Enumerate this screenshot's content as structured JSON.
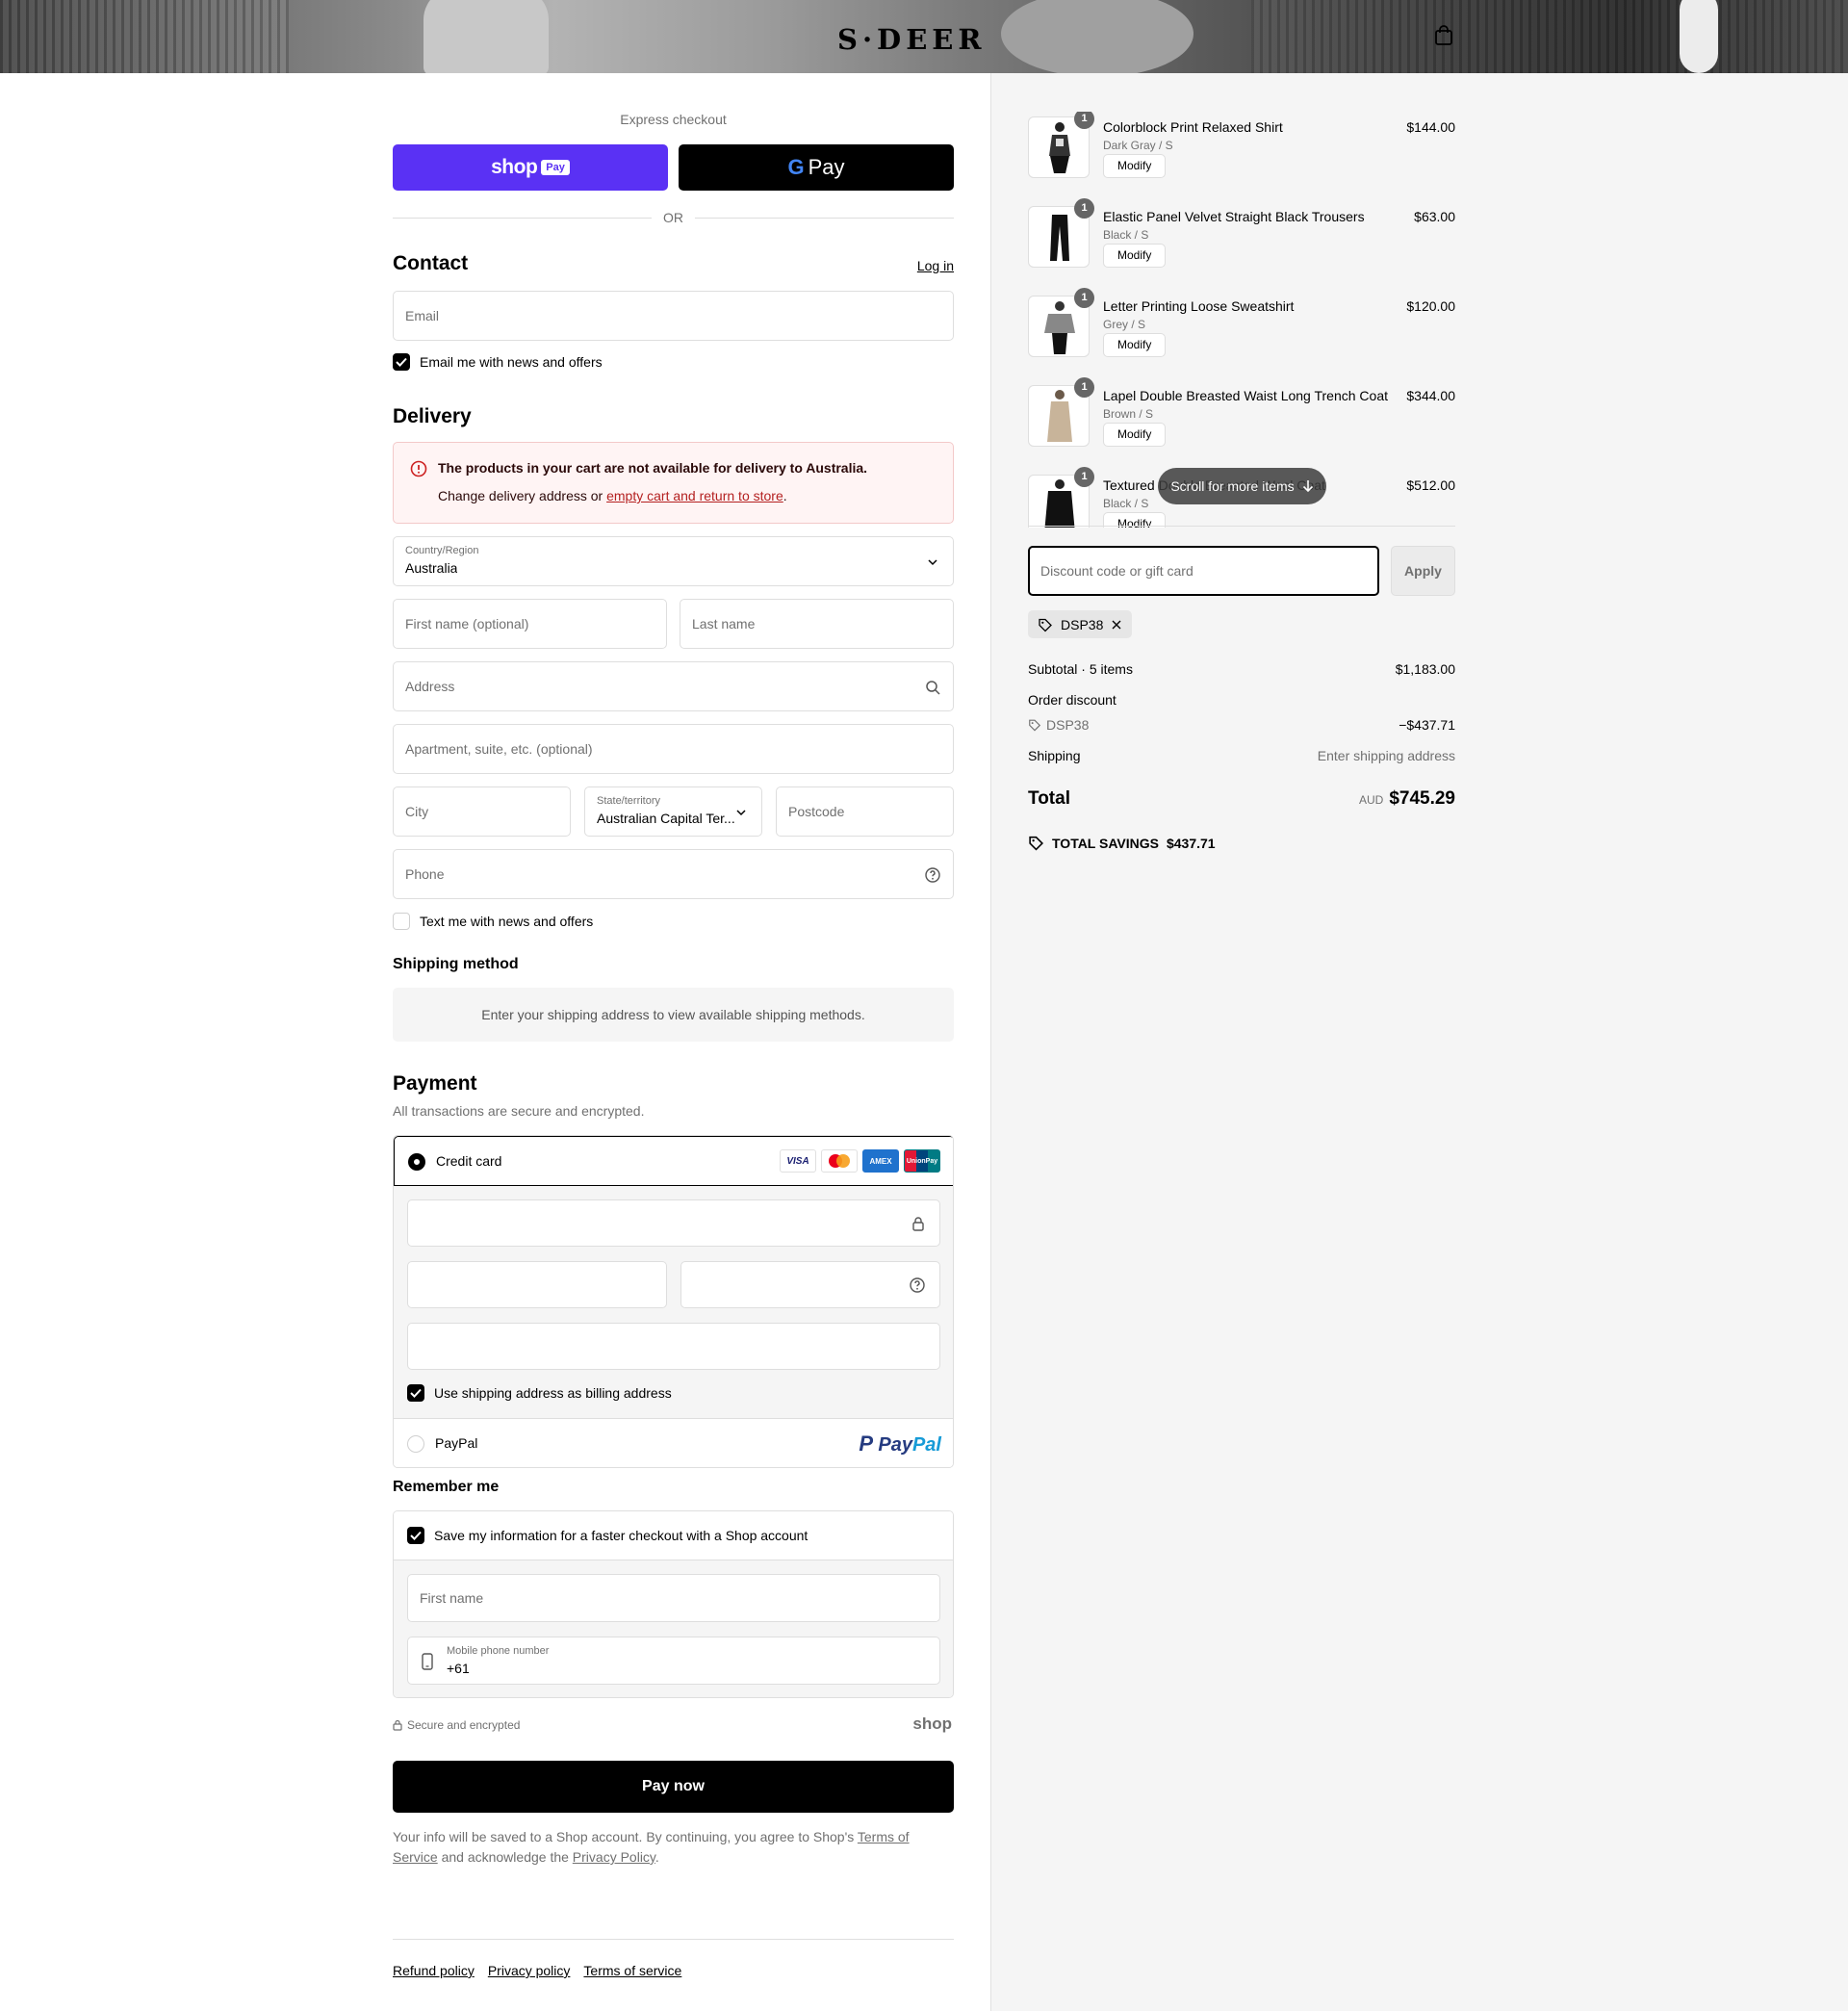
{
  "header": {
    "brand": "S·DEER",
    "bag_icon": "shopping-bag-icon"
  },
  "express": {
    "label": "Express checkout",
    "shop_pay": {
      "word": "shop",
      "pill": "Pay"
    },
    "google_pay": {
      "g": "G",
      "pay": "Pay"
    },
    "or": "OR"
  },
  "contact": {
    "title": "Contact",
    "login": "Log in",
    "email_placeholder": "Email",
    "newsletter": "Email me with news and offers"
  },
  "delivery": {
    "title": "Delivery",
    "alert_title": "The products in your cart are not available for delivery to Australia.",
    "alert_body_prefix": "Change delivery address or ",
    "alert_link": "empty cart and return to store",
    "alert_body_suffix": ".",
    "country_label": "Country/Region",
    "country_value": "Australia",
    "first_name": "First name (optional)",
    "last_name": "Last name",
    "address": "Address",
    "apartment": "Apartment, suite, etc. (optional)",
    "city": "City",
    "state_label": "State/territory",
    "state_value": "Australian Capital Ter...",
    "postcode": "Postcode",
    "phone": "Phone",
    "sms": "Text me with news and offers"
  },
  "shipping_method": {
    "title": "Shipping method",
    "message": "Enter your shipping address to view available shipping methods."
  },
  "payment": {
    "title": "Payment",
    "subtitle": "All transactions are secure and encrypted.",
    "credit_card": "Credit card",
    "cards": [
      "VISA",
      "MC",
      "AMEX",
      "UnionPay"
    ],
    "billing_same": "Use shipping address as billing address",
    "paypal": "PayPal",
    "paypal_logo_a": "Pay",
    "paypal_logo_b": "Pal"
  },
  "remember": {
    "title": "Remember me",
    "save_info": "Save my information for a faster checkout with a Shop account",
    "first_name": "First name",
    "phone_label": "Mobile phone number",
    "phone_value": "+61"
  },
  "secure": {
    "text": "Secure and encrypted",
    "shop": "shop"
  },
  "pay_now": "Pay now",
  "legal": {
    "prefix": "Your info will be saved to a Shop account. By continuing, you agree to Shop's ",
    "terms": "Terms of Service",
    "middle": " and acknowledge the ",
    "privacy": "Privacy Policy",
    "suffix": "."
  },
  "footer": {
    "refund": "Refund policy",
    "privacy": "Privacy policy",
    "terms": "Terms of service"
  },
  "cart": {
    "items": [
      {
        "qty": "1",
        "name": "Colorblock Print Relaxed Shirt",
        "variant": "Dark Gray / S",
        "price": "$144.00",
        "modify": "Modify"
      },
      {
        "qty": "1",
        "name": "Elastic Panel Velvet Straight Black Trousers",
        "variant": "Black / S",
        "price": "$63.00",
        "modify": "Modify"
      },
      {
        "qty": "1",
        "name": "Letter Printing Loose Sweatshirt",
        "variant": "Grey / S",
        "price": "$120.00",
        "modify": "Modify"
      },
      {
        "qty": "1",
        "name": "Lapel Double Breasted Waist Long Trench Coat",
        "variant": "Brown / S",
        "price": "$344.00",
        "modify": "Modify"
      },
      {
        "qty": "1",
        "name": "Textured Double Breasted Wool Coat",
        "variant": "Black / S",
        "price": "$512.00",
        "modify": "Modify"
      }
    ],
    "scroll_hint": "Scroll for more items",
    "discount_placeholder": "Discount code or gift card",
    "apply": "Apply",
    "applied_code": "DSP38",
    "subtotal_label": "Subtotal · 5 items",
    "subtotal_value": "$1,183.00",
    "order_discount_label": "Order discount",
    "discount_code": "DSP38",
    "discount_value": "−$437.71",
    "shipping_label": "Shipping",
    "shipping_value": "Enter shipping address",
    "total_label": "Total",
    "currency": "AUD",
    "total_value": "$745.29",
    "savings_label": "TOTAL SAVINGS",
    "savings_value": "$437.71"
  }
}
